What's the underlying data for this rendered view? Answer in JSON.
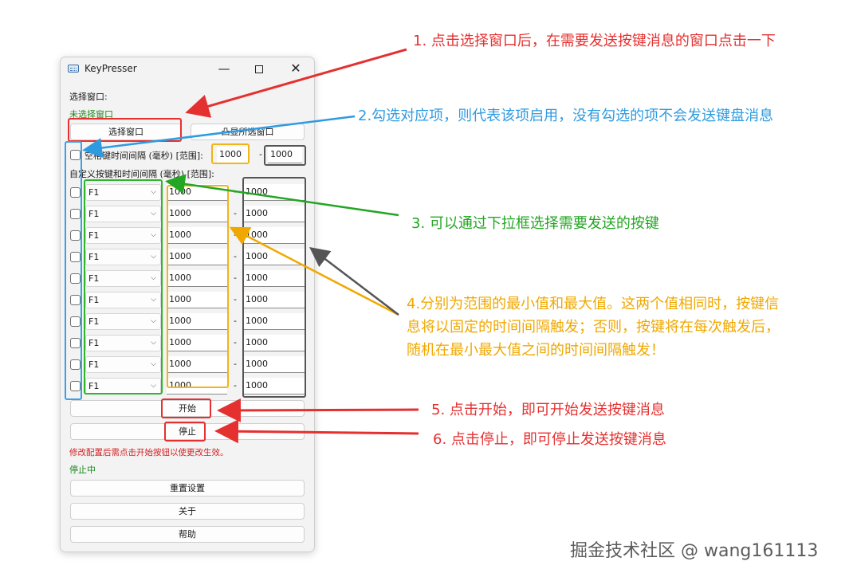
{
  "window": {
    "title": "KeyPresser",
    "minimize_glyph": "—",
    "close_glyph": "✕"
  },
  "select_window": {
    "label": "选择窗口:",
    "status": "未选择窗口",
    "select_button": "选择窗口",
    "show_button": "凸显所选窗口"
  },
  "space_key": {
    "label": "空格键时间间隔 (毫秒) [范围]:",
    "min": "1000",
    "max": "1000",
    "separator": "-"
  },
  "custom_keys": {
    "label": "自定义按键和时间间隔 (毫秒) [范围]:",
    "rows": [
      {
        "key": "F1",
        "min": "1000",
        "max": "1000"
      },
      {
        "key": "F1",
        "min": "1000",
        "max": "1000"
      },
      {
        "key": "F1",
        "min": "1000",
        "max": "1000"
      },
      {
        "key": "F1",
        "min": "1000",
        "max": "1000"
      },
      {
        "key": "F1",
        "min": "1000",
        "max": "1000"
      },
      {
        "key": "F1",
        "min": "1000",
        "max": "1000"
      },
      {
        "key": "F1",
        "min": "1000",
        "max": "1000"
      },
      {
        "key": "F1",
        "min": "1000",
        "max": "1000"
      },
      {
        "key": "F1",
        "min": "1000",
        "max": "1000"
      },
      {
        "key": "F1",
        "min": "1000",
        "max": "1000"
      }
    ]
  },
  "controls": {
    "start": "开始",
    "stop": "停止",
    "warning": "修改配置后需点击开始按钮以使更改生效。",
    "status": "停止中",
    "reset": "重置设置",
    "about": "关于",
    "help": "帮助"
  },
  "annotations": {
    "note1": "1. 点击选择窗口后，在需要发送按键消息的窗口点击一下",
    "note2": "2.勾选对应项，则代表该项启用，没有勾选的项不会发送键盘消息",
    "note3": "3. 可以通过下拉框选择需要发送的按键",
    "note4_line1": "4.分别为范围的最小值和最大值。这两个值相同时，按键信",
    "note4_line2": "息将以固定的时间间隔触发；否则，按键将在每次触发后，",
    "note4_line3": "随机在最小最大值之间的时间间隔触发！",
    "note5": "5. 点击开始，即可开始发送按键消息",
    "note6": "6. 点击停止，即可停止发送按键消息",
    "colors": {
      "red": "#e53030",
      "blue": "#2e9be0",
      "green": "#23a623",
      "orange": "#f0a800",
      "dark": "#555555"
    }
  },
  "watermark": "掘金技术社区 @ wang161113"
}
